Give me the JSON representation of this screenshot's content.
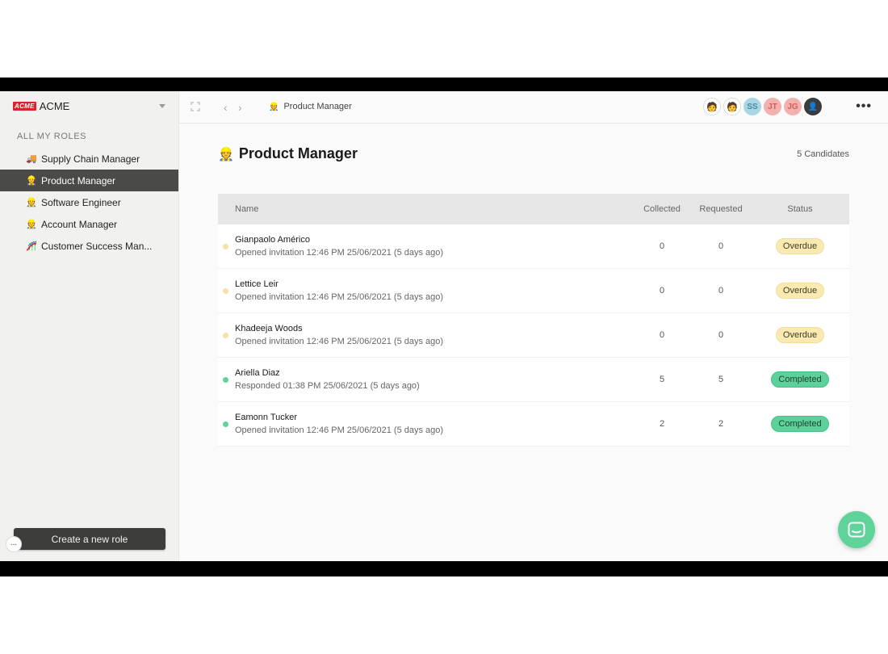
{
  "sidebar": {
    "brand_logo": "ACME",
    "brand_name": "ACME",
    "section_label": "ALL MY ROLES",
    "roles": [
      {
        "emoji": "🚚",
        "label": "Supply Chain Manager"
      },
      {
        "emoji": "👷",
        "label": "Product Manager"
      },
      {
        "emoji": "👷",
        "label": "Software Engineer"
      },
      {
        "emoji": "👷",
        "label": "Account Manager"
      },
      {
        "emoji": "🎢",
        "label": "Customer Success Man..."
      }
    ],
    "active_index": 1,
    "create_button": "Create a new role",
    "more_label": "..."
  },
  "topbar": {
    "breadcrumb_emoji": "👷",
    "breadcrumb": "Product Manager",
    "avatars": [
      {
        "label": "🧑",
        "kind": "sketch"
      },
      {
        "label": "🧑",
        "kind": "sketch"
      },
      {
        "label": "SS",
        "kind": "ss"
      },
      {
        "label": "JT",
        "kind": "jt"
      },
      {
        "label": "JG",
        "kind": "jg"
      },
      {
        "label": "👤",
        "kind": "photo"
      }
    ],
    "menu": "•••"
  },
  "page": {
    "title_emoji": "👷",
    "title": "Product Manager",
    "candidate_count": "5 Candidates"
  },
  "table": {
    "headers": {
      "name": "Name",
      "collected": "Collected",
      "requested": "Requested",
      "status": "Status"
    },
    "rows": [
      {
        "name": "Gianpaolo Américo",
        "sub": "Opened invitation 12:46 PM 25/06/2021 (5 days ago)",
        "collected": "0",
        "requested": "0",
        "status": "Overdue",
        "state": "overdue"
      },
      {
        "name": "Lettice Leir",
        "sub": "Opened invitation 12:46 PM 25/06/2021 (5 days ago)",
        "collected": "0",
        "requested": "0",
        "status": "Overdue",
        "state": "overdue"
      },
      {
        "name": "Khadeeja Woods",
        "sub": "Opened invitation 12:46 PM 25/06/2021 (5 days ago)",
        "collected": "0",
        "requested": "0",
        "status": "Overdue",
        "state": "overdue"
      },
      {
        "name": "Ariella Diaz",
        "sub": "Responded 01:38 PM 25/06/2021 (5 days ago)",
        "collected": "5",
        "requested": "5",
        "status": "Completed",
        "state": "completed"
      },
      {
        "name": "Eamonn Tucker",
        "sub": "Opened invitation 12:46 PM 25/06/2021 (5 days ago)",
        "collected": "2",
        "requested": "2",
        "status": "Completed",
        "state": "completed"
      }
    ]
  },
  "colors": {
    "accent_green": "#5fd39a",
    "overdue_yellow": "#faeab2",
    "sidebar_active": "#4a4a49"
  }
}
